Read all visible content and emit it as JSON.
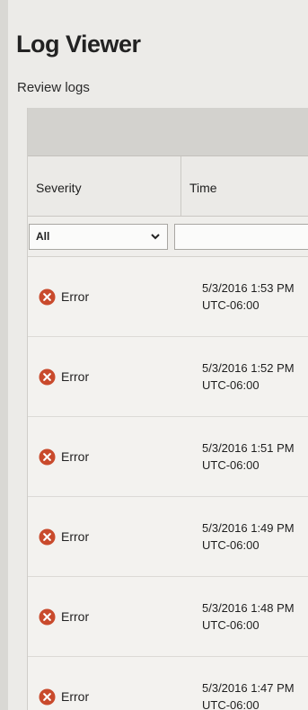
{
  "page": {
    "title": "Log Viewer",
    "subtitle": "Review logs"
  },
  "columns": {
    "severity": "Severity",
    "time": "Time"
  },
  "filters": {
    "severity_value": "All",
    "time_value": ""
  },
  "colors": {
    "error": "#c94a2c",
    "background": "#ecebe8"
  },
  "icons": {
    "severity": "error-icon",
    "dropdown": "chevron-down-icon"
  },
  "rows": [
    {
      "severity": "Error",
      "date": "5/3/2016 1:53 PM",
      "tz": "UTC-06:00"
    },
    {
      "severity": "Error",
      "date": "5/3/2016 1:52 PM",
      "tz": "UTC-06:00"
    },
    {
      "severity": "Error",
      "date": "5/3/2016 1:51 PM",
      "tz": "UTC-06:00"
    },
    {
      "severity": "Error",
      "date": "5/3/2016 1:49 PM",
      "tz": "UTC-06:00"
    },
    {
      "severity": "Error",
      "date": "5/3/2016 1:48 PM",
      "tz": "UTC-06:00"
    },
    {
      "severity": "Error",
      "date": "5/3/2016 1:47 PM",
      "tz": "UTC-06:00"
    }
  ]
}
